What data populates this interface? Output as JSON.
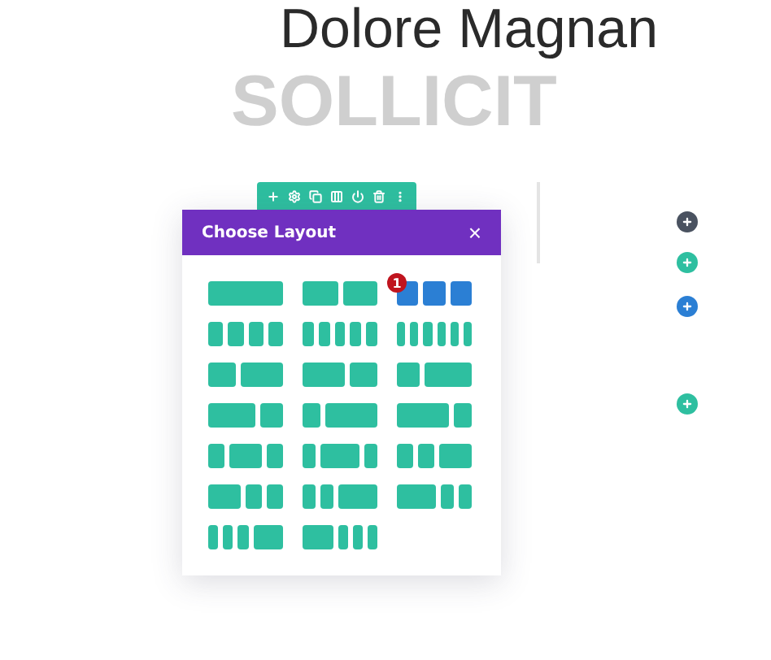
{
  "heading": "Dolore Magnan",
  "background_heading": "SOLLICIT",
  "modal": {
    "title": "Choose Layout",
    "close": "×",
    "layouts": [
      {
        "columns": [
          {
            "kind": "full"
          }
        ],
        "selected": false
      },
      {
        "columns": [
          {
            "kind": "half"
          },
          {
            "kind": "half"
          }
        ],
        "selected": false
      },
      {
        "columns": [
          {
            "kind": "third"
          },
          {
            "kind": "third"
          },
          {
            "kind": "third"
          }
        ],
        "selected": true,
        "badge": "1"
      },
      {
        "columns": [
          {
            "kind": "quarter"
          },
          {
            "kind": "quarter"
          },
          {
            "kind": "quarter"
          },
          {
            "kind": "quarter"
          }
        ],
        "selected": false
      },
      {
        "columns": [
          {
            "kind": "fifth"
          },
          {
            "kind": "fifth"
          },
          {
            "kind": "fifth"
          },
          {
            "kind": "fifth"
          },
          {
            "kind": "fifth"
          }
        ],
        "selected": false
      },
      {
        "columns": [
          {
            "kind": "sixth"
          },
          {
            "kind": "sixth"
          },
          {
            "kind": "sixth"
          },
          {
            "kind": "sixth"
          },
          {
            "kind": "sixth"
          },
          {
            "kind": "sixth"
          }
        ],
        "selected": false
      },
      {
        "columns": [
          {
            "kind": "twofifths"
          },
          {
            "kind": "threefifths"
          }
        ],
        "selected": false
      },
      {
        "columns": [
          {
            "kind": "threefifths"
          },
          {
            "kind": "twofifths"
          }
        ],
        "selected": false
      },
      {
        "columns": [
          {
            "kind": "third"
          },
          {
            "kind": "twothirds"
          }
        ],
        "selected": false
      },
      {
        "columns": [
          {
            "kind": "twothirds"
          },
          {
            "kind": "third"
          }
        ],
        "selected": false
      },
      {
        "columns": [
          {
            "kind": "quarter"
          },
          {
            "kind": "threequarters"
          }
        ],
        "selected": false
      },
      {
        "columns": [
          {
            "kind": "threequarters"
          },
          {
            "kind": "quarter"
          }
        ],
        "selected": false
      },
      {
        "columns": [
          {
            "kind": "quarter"
          },
          {
            "kind": "half"
          },
          {
            "kind": "quarter"
          }
        ],
        "selected": false
      },
      {
        "columns": [
          {
            "kind": "fifth"
          },
          {
            "kind": "threefifths"
          },
          {
            "kind": "fifth"
          }
        ],
        "selected": false
      },
      {
        "columns": [
          {
            "kind": "quarter"
          },
          {
            "kind": "quarter"
          },
          {
            "kind": "half"
          }
        ],
        "selected": false
      },
      {
        "columns": [
          {
            "kind": "half"
          },
          {
            "kind": "quarter"
          },
          {
            "kind": "quarter"
          }
        ],
        "selected": false
      },
      {
        "columns": [
          {
            "kind": "fifth"
          },
          {
            "kind": "fifth"
          },
          {
            "kind": "threefifths"
          }
        ],
        "selected": false
      },
      {
        "columns": [
          {
            "kind": "threefifths"
          },
          {
            "kind": "fifth"
          },
          {
            "kind": "fifth"
          }
        ],
        "selected": false
      },
      {
        "columns": [
          {
            "kind": "sixth"
          },
          {
            "kind": "sixth"
          },
          {
            "kind": "sixth"
          },
          {
            "kind": "half"
          }
        ],
        "selected": false
      },
      {
        "columns": [
          {
            "kind": "half"
          },
          {
            "kind": "sixth"
          },
          {
            "kind": "sixth"
          },
          {
            "kind": "sixth"
          }
        ],
        "selected": false
      }
    ]
  },
  "add_buttons": [
    {
      "color": "#4a5260"
    },
    {
      "color": "#2ebfa0"
    },
    {
      "color": "#2b7fd4"
    },
    {
      "color": "#2ebfa0"
    }
  ]
}
